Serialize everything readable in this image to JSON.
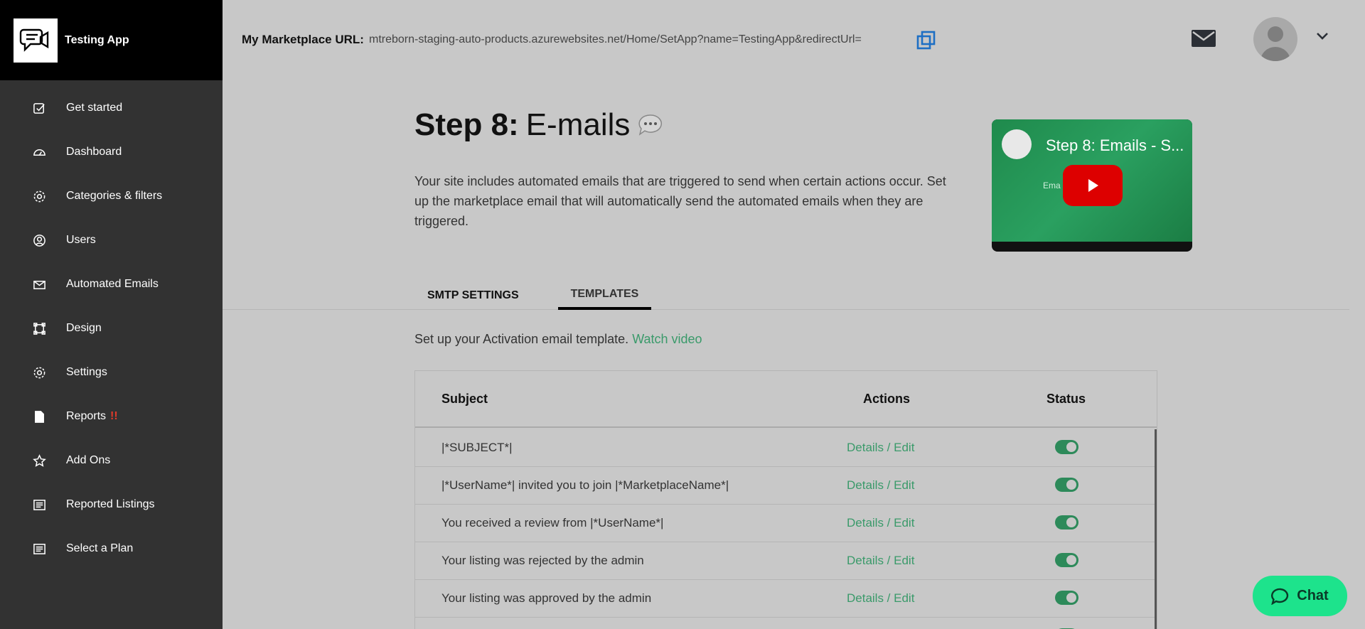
{
  "brand": {
    "name": "Testing App"
  },
  "sidebar": {
    "items": [
      {
        "label": "Get started",
        "icon": "checkbox-icon"
      },
      {
        "label": "Dashboard",
        "icon": "gauge-icon"
      },
      {
        "label": "Categories & filters",
        "icon": "gear-icon"
      },
      {
        "label": "Users",
        "icon": "user-circle-icon"
      },
      {
        "label": "Automated Emails",
        "icon": "envelope-icon"
      },
      {
        "label": "Design",
        "icon": "vector-square-icon"
      },
      {
        "label": "Settings",
        "icon": "gear-icon"
      },
      {
        "label": "Reports",
        "icon": "file-icon",
        "alert": "!!"
      },
      {
        "label": "Add Ons",
        "icon": "star-icon"
      },
      {
        "label": "Reported Listings",
        "icon": "list-icon"
      },
      {
        "label": "Select a Plan",
        "icon": "list-icon"
      }
    ]
  },
  "topbar": {
    "url_label": "My Marketplace URL:",
    "url_value": "mtreborn-staging-auto-products.azurewebsites.net/Home/SetApp?name=TestingApp&redirectUrl="
  },
  "page": {
    "title_bold": "Step 8:",
    "title_rest": "E-mails",
    "description": "Your site includes automated emails that are triggered to send when certain actions occur. Set up the marketplace email that will automatically send the automated emails when they are triggered.",
    "video": {
      "title": "Step 8: Emails - S...",
      "subtitle": "Ema          ings"
    },
    "tabs": [
      {
        "label": "SMTP SETTINGS",
        "active": false
      },
      {
        "label": "TEMPLATES",
        "active": true
      }
    ],
    "intro_text": "Set up your Activation email template.",
    "intro_link": "Watch video"
  },
  "table": {
    "headers": {
      "subject": "Subject",
      "actions": "Actions",
      "status": "Status"
    },
    "rows": [
      {
        "subject": "|*SUBJECT*|",
        "action": "Details / Edit",
        "status": "on"
      },
      {
        "subject": "|*UserName*| invited you to join |*MarketplaceName*|",
        "action": "Details / Edit",
        "status": "on"
      },
      {
        "subject": "You received a review from |*UserName*|",
        "action": "Details / Edit",
        "status": "on"
      },
      {
        "subject": "Your listing was rejected by the admin",
        "action": "Details / Edit",
        "status": "on"
      },
      {
        "subject": "Your listing was approved by the admin",
        "action": "Details / Edit",
        "status": "on"
      }
    ]
  },
  "chat": {
    "label": "Chat"
  },
  "colors": {
    "accent": "#3a9a6a",
    "chat": "#1de38c",
    "sidebar": "#323232",
    "alert": "#e03a2a"
  }
}
